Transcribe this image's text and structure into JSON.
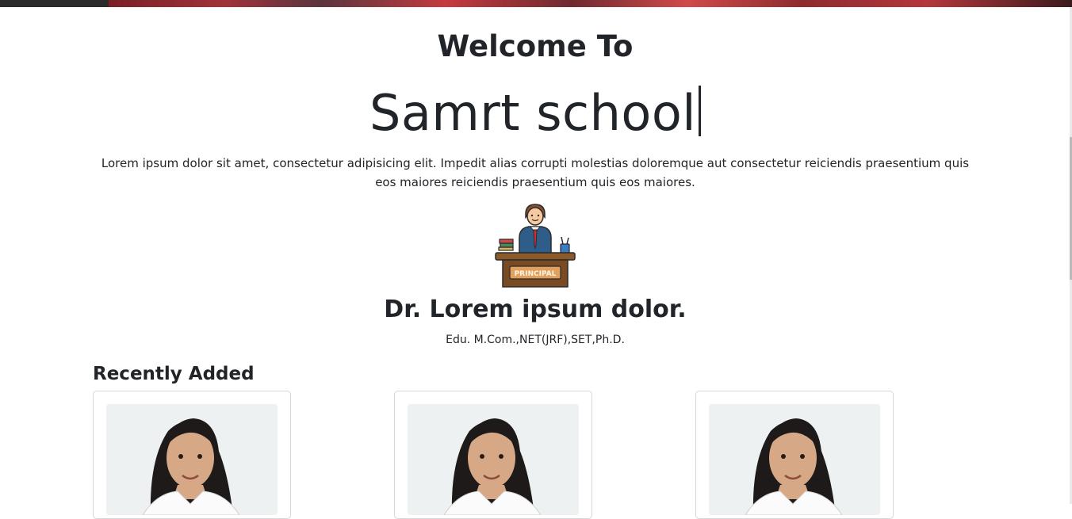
{
  "header": {
    "welcome": "Welcome To",
    "school_name": "Samrt school",
    "intro": "Lorem ipsum dolor sit amet, consectetur adipisicing elit. Impedit alias corrupti molestias doloremque aut consectetur reiciendis praesentium quis eos maiores reiciendis praesentium quis eos maiores."
  },
  "principal": {
    "icon": "principal-at-desk-icon",
    "desk_label": "PRINCIPAL",
    "name": "Dr. Lorem ipsum dolor.",
    "education": "Edu. M.Com.,NET(JRF),SET,Ph.D."
  },
  "recent": {
    "heading": "Recently Added",
    "cards": [
      {
        "image": "student-photo"
      },
      {
        "image": "student-photo"
      },
      {
        "image": "student-photo"
      }
    ]
  },
  "colors": {
    "text": "#212529",
    "card_border": "#d6d6d6",
    "hero": "#a1323a"
  }
}
